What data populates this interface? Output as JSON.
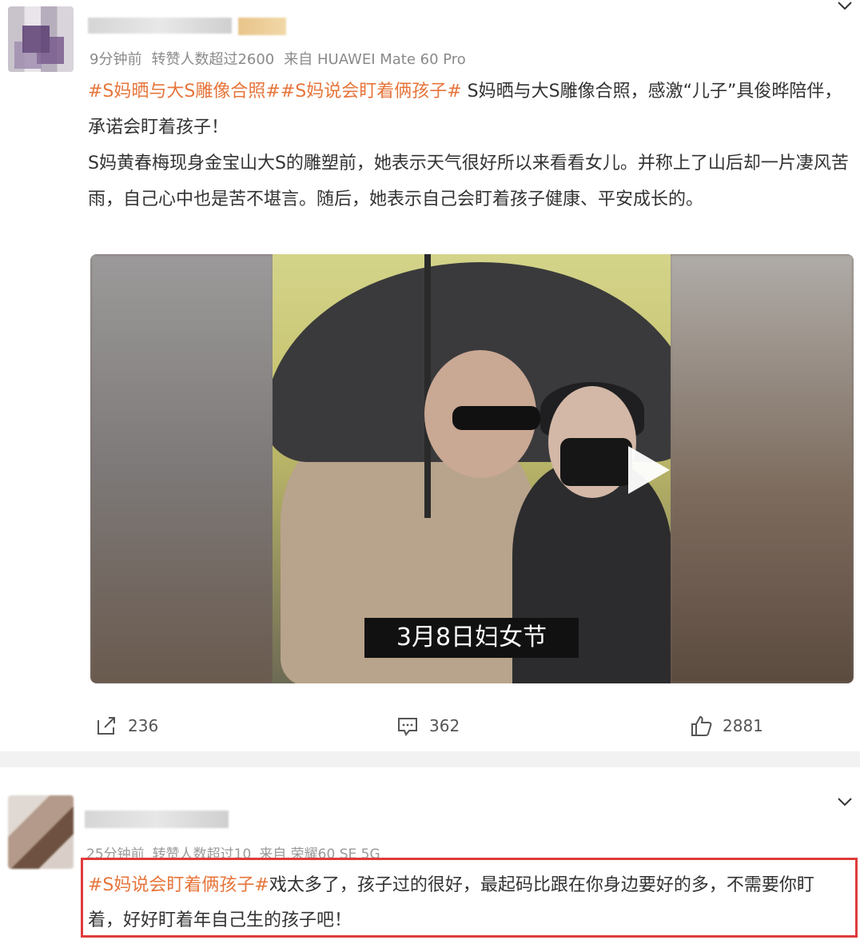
{
  "post": {
    "time": "9分钟前",
    "reposts_info": "转赞人数超过2600",
    "source": "来自 HUAWEI Mate 60 Pro",
    "tag1": "#S妈晒与大S雕像合照#",
    "tag2": "#S妈说会盯着俩孩子#",
    "text1": " S妈晒与大S雕像合照，感激“儿子”具俊晔陪伴，承诺会盯着孩子！",
    "text2": "S妈黄春梅现身金宝山大S的雕塑前，她表示天气很好所以来看看女儿。并称上了山后却一片凄风苦雨，自己心中也是苦不堪言。随后，她表示自己会盯着孩子健康、平安成长的。",
    "video_caption": "3月8日妇女节"
  },
  "actions": {
    "repost_count": "236",
    "comment_count": "362",
    "like_count": "2881"
  },
  "comment": {
    "time": "25分钟前",
    "reposts_info": "转赞人数超过10",
    "source": "来自 荣耀60 SE 5G",
    "tag": "#S妈说会盯着俩孩子#",
    "text": "戏太多了，孩子过的很好，最起码比跟在你身边要好的多，不需要你盯着，好好盯着年自己生的孩子吧！"
  },
  "icons": {
    "repost": "repost-icon",
    "comment": "comment-icon",
    "like": "thumbs-up-icon",
    "more": "chevron-down-icon",
    "play": "play-icon"
  },
  "colors": {
    "tag": "#e6753b",
    "highlight_border": "#e03b3b"
  }
}
